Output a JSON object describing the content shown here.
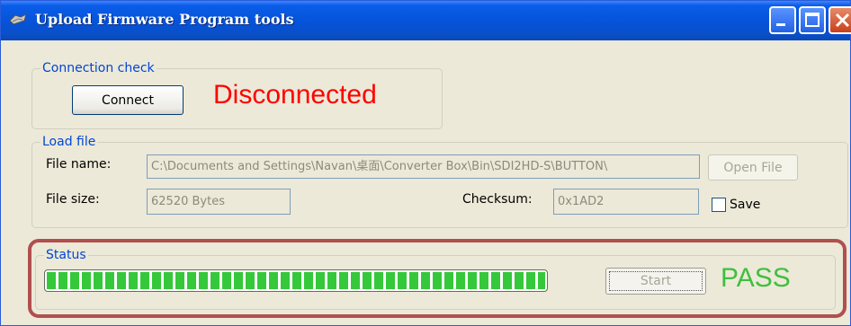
{
  "window": {
    "title": "Upload Firmware Program tools"
  },
  "connection": {
    "legend": "Connection check",
    "connect_label": "Connect",
    "state_text": "Disconnected",
    "state_color": "#ff0000"
  },
  "load_file": {
    "legend": "Load file",
    "file_name_label": "File name:",
    "file_name_value": "C:\\Documents and Settings\\Navan\\桌面\\Converter Box\\Bin\\SDI2HD-S\\BUTTON\\",
    "open_file_label": "Open File",
    "file_size_label": "File size:",
    "file_size_value": "62520 Bytes",
    "checksum_label": "Checksum:",
    "checksum_value": "0x1AD2",
    "save_label": "Save",
    "save_checked": false
  },
  "status": {
    "legend": "Status",
    "progress_percent": 100,
    "start_label": "Start",
    "result_text": "PASS",
    "result_color": "#3fbf3f"
  },
  "icons": [
    "app-icon",
    "minimize-icon",
    "maximize-icon",
    "close-icon"
  ]
}
